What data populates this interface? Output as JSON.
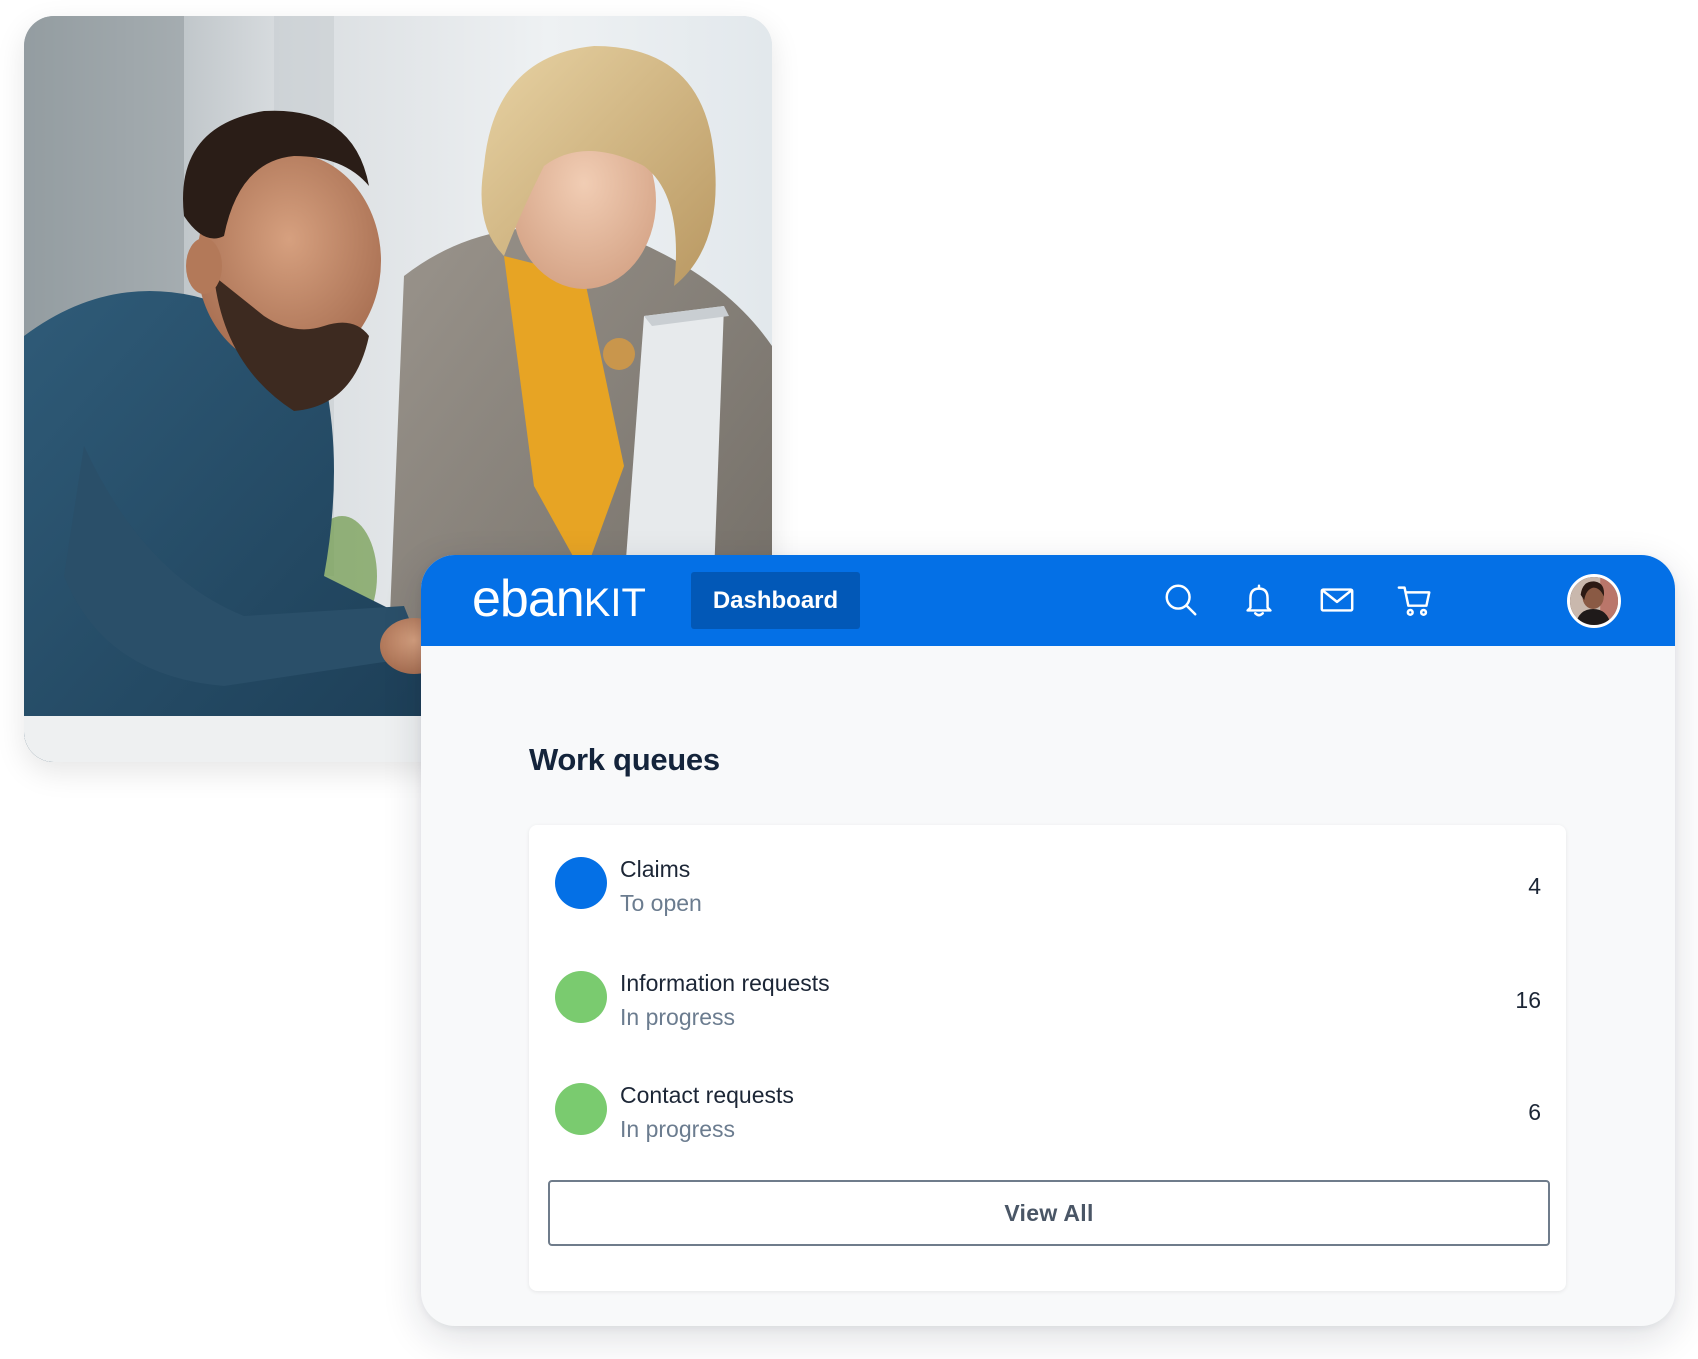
{
  "brand": {
    "logo_main": "eban",
    "logo_suffix": "KIT",
    "primary_color": "#0470e6",
    "tab_active_color": "#0258b7"
  },
  "topbar": {
    "active_tab": "Dashboard",
    "icons": [
      "search-icon",
      "bell-icon",
      "mail-icon",
      "cart-icon",
      "user-avatar"
    ]
  },
  "work_queues": {
    "title": "Work queues",
    "items": [
      {
        "name": "Claims",
        "status": "To open",
        "count": "4",
        "color": "#0470e6"
      },
      {
        "name": "Information requests",
        "status": "In progress",
        "count": "16",
        "color": "#7acb6f"
      },
      {
        "name": "Contact requests",
        "status": "In progress",
        "count": "6",
        "color": "#7acb6f"
      }
    ],
    "view_all_label": "View All"
  }
}
